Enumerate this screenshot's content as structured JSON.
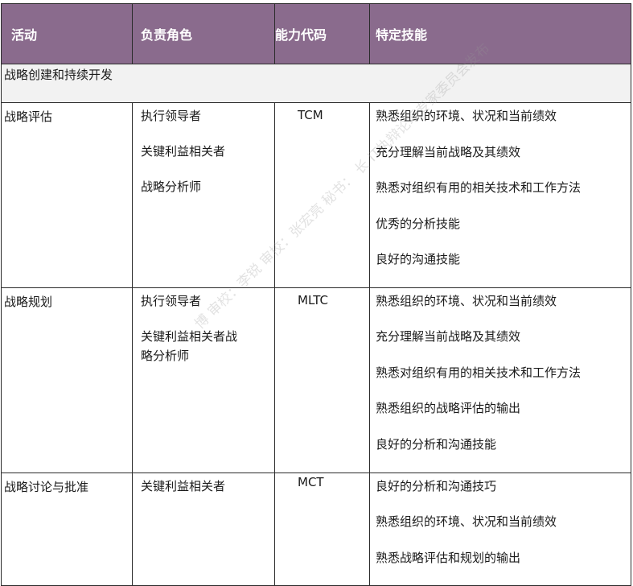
{
  "headers": {
    "activity": "活动",
    "role": "负责角色",
    "code": "能力代码",
    "skills": "特定技能"
  },
  "section_title": "战略创建和持续开发",
  "rows": [
    {
      "activity": "战略评估",
      "roles": [
        "执行领导者",
        "关键利益相关者",
        "战略分析师"
      ],
      "code": "TCM",
      "skills": [
        "熟悉组织的环境、状况和当前绩效",
        "充分理解当前战略及其绩效",
        "熟悉对组织有用的相关技术和工作方法",
        "优秀的分析技能",
        "良好的沟通技能"
      ]
    },
    {
      "activity": "战略规划",
      "roles": [
        "执行领导者",
        "关键利益相关者战",
        "略分析师"
      ],
      "code": "MLTC",
      "skills": [
        "熟悉组织的环境、状况和当前绩效",
        "充分理解当前战略及其绩效",
        "熟悉对组织有用的相关技术和工作方法",
        "熟悉组织的战略评估的输出",
        "良好的分析和沟通技能"
      ]
    },
    {
      "activity": "战略讨论与批准",
      "roles": [
        "关键利益相关者"
      ],
      "code": "MCT",
      "skills": [
        "良好的分析和沟通技巧",
        "熟悉组织的环境、状况和当前绩效",
        "熟悉战略评估和规划的输出"
      ]
    }
  ],
  "watermark": "博  审校：李锐  审校：张宏亮  秘书：  长  IT执辩论坛专家委员会发布"
}
